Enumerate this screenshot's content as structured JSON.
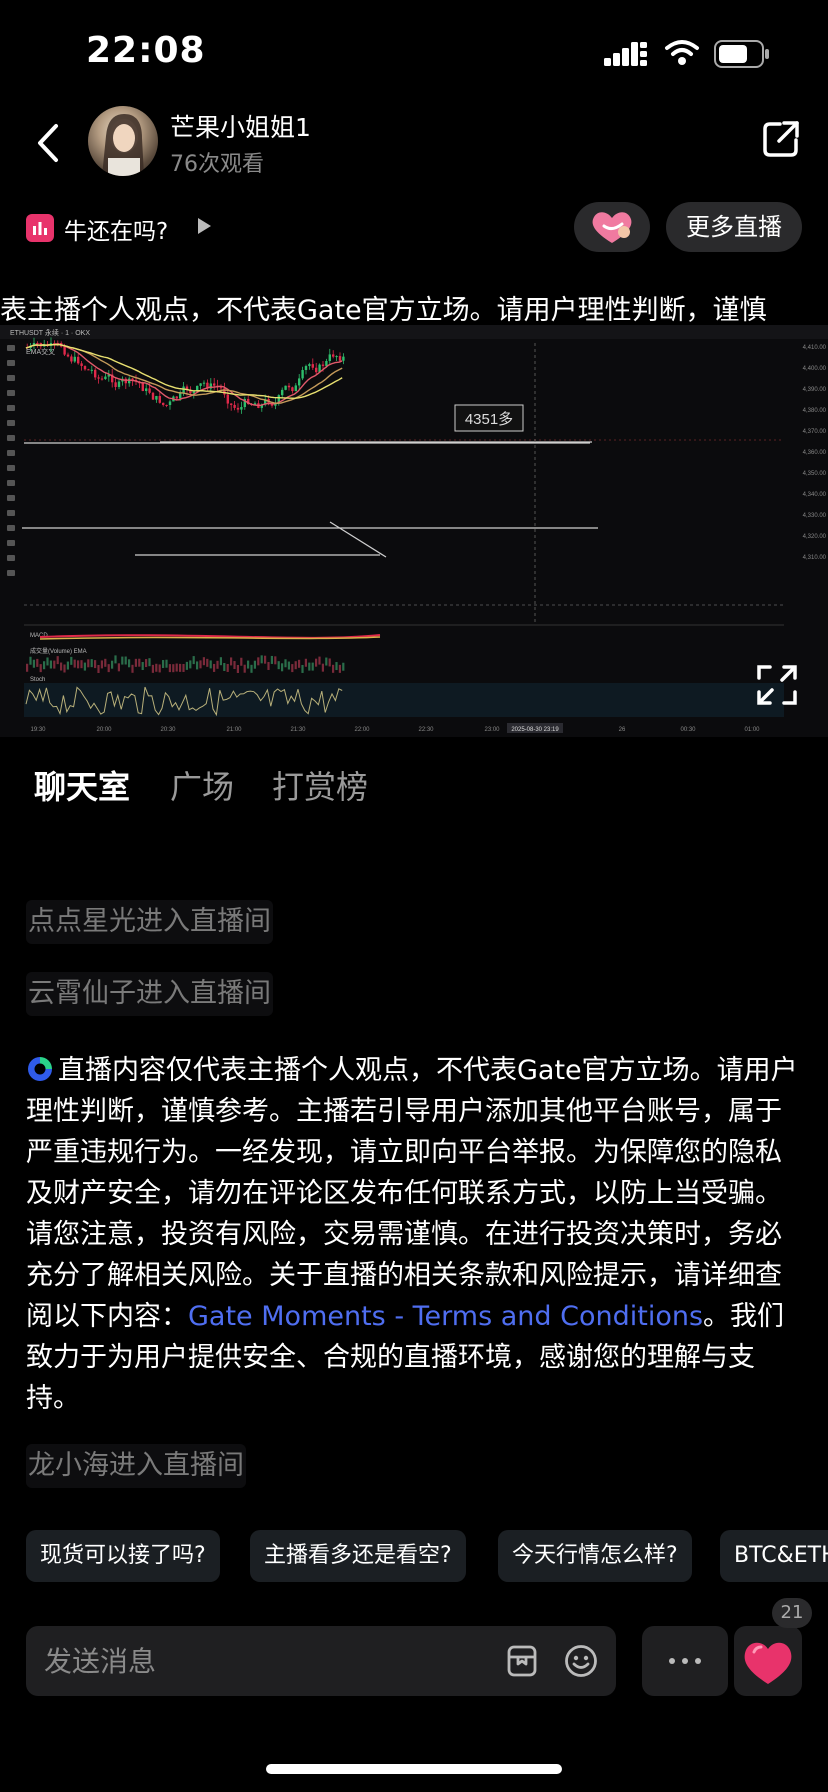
{
  "status_bar": {
    "time": "22:08"
  },
  "header": {
    "host_name": "芒果小姐姐1",
    "view_count": "76次观看"
  },
  "topic": {
    "title": "牛还在吗?",
    "more_live_label": "更多直播"
  },
  "marquee_text": "表主播个人观点，不代表Gate官方立场。请用户理性判断，谨慎",
  "chart": {
    "symbol_label": "ETHUSDT 永续 · 1 · OKX",
    "ema_label": "EMA交叉",
    "macd_label": "MACD",
    "volume_label": "成交量(Volume) EMA",
    "stoch_label": "Stoch",
    "annotation": "4351多",
    "y_ticks": [
      "4,410.00",
      "4,400.00",
      "4,390.00",
      "4,380.00",
      "4,370.00",
      "4,360.00",
      "4,350.00",
      "4,340.00",
      "4,330.00",
      "4,320.00",
      "4,310.00"
    ],
    "x_ticks": [
      "19:30",
      "20:00",
      "20:30",
      "21:00",
      "21:30",
      "22:00",
      "22:30",
      "23:00",
      "2025-08-30 23:19",
      "26",
      "00:30",
      "01:00"
    ]
  },
  "tabs": [
    "聊天室",
    "广场",
    "打赏榜"
  ],
  "chat": {
    "join_messages": [
      "点点星光进入直播间",
      "云霄仙子进入直播间",
      "龙小海进入直播间"
    ],
    "notice_before_link": "直播内容仅代表主播个人观点，不代表Gate官方立场。请用户理性判断，谨慎参考。主播若引导用户添加其他平台账号，属于严重违规行为。一经发现，请立即向平台举报。为保障您的隐私及财产安全，请勿在评论区发布任何联系方式，以防上当受骗。请您注意，投资有风险，交易需谨慎。在进行投资决策时，务必充分了解相关风险。关于直播的相关条款和风险提示，请详细查阅以下内容：",
    "notice_link": "Gate Moments - Terms and Conditions",
    "notice_after_link": "。我们致力于为用户提供安全、合规的直播环境，感谢您的理解与支持。"
  },
  "quick_questions": [
    "现货可以接了吗?",
    "主播看多还是看空?",
    "今天行情怎么样?",
    "BTC&ETH"
  ],
  "input": {
    "placeholder": "发送消息"
  },
  "like_count": "21",
  "colors": {
    "accent_link": "#4f6ef0",
    "topic_icon": "#e8336b",
    "like_heart": "#e8336b"
  },
  "icons": [
    "back-icon",
    "share-icon",
    "bar-chart-icon",
    "play-icon",
    "heart-hands-icon",
    "expand-icon",
    "gate-logo-icon",
    "gift-box-icon",
    "emoji-icon",
    "more-dots-icon",
    "heart-icon"
  ]
}
